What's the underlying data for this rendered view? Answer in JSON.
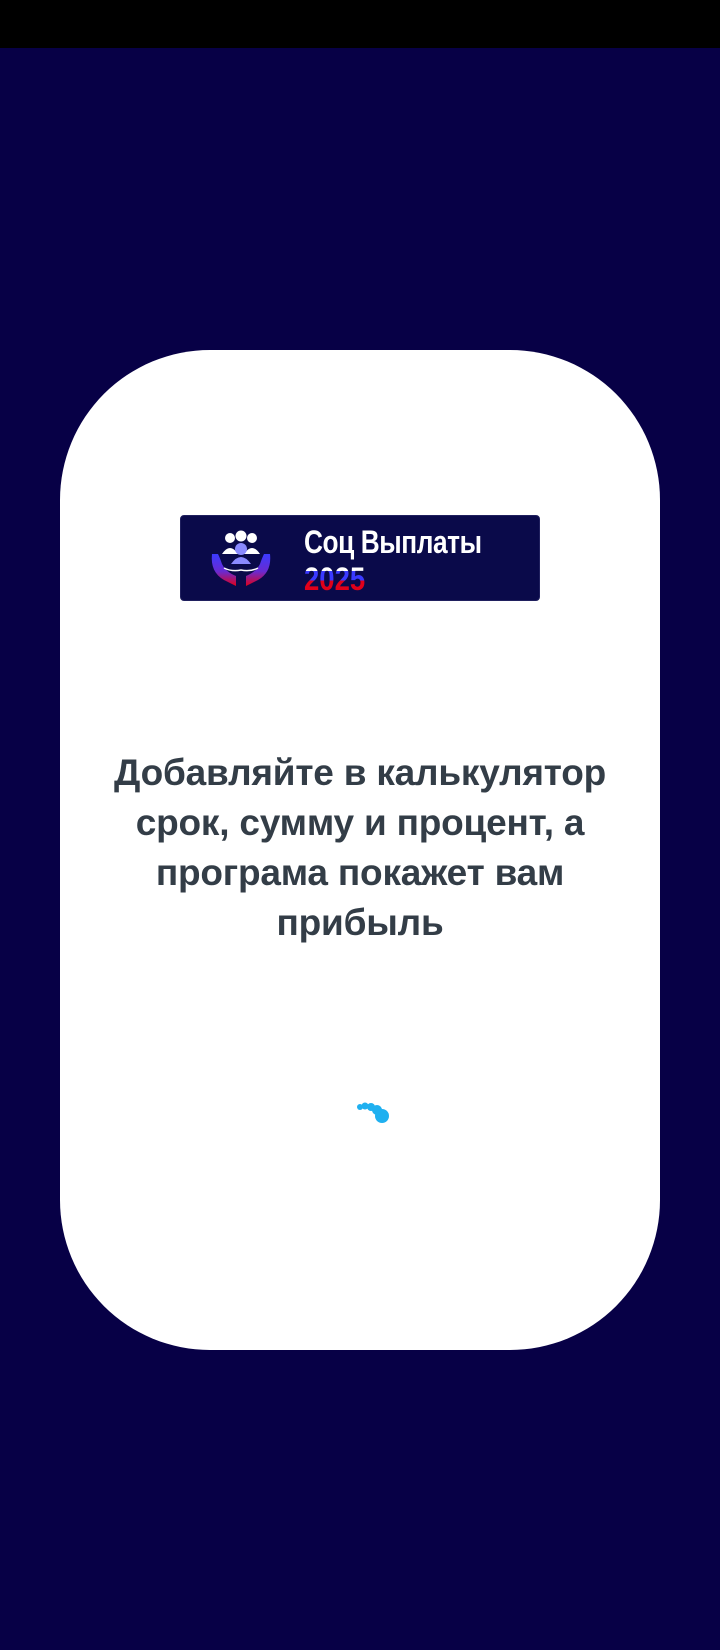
{
  "app": {
    "logo_title": "Соц Выплаты",
    "logo_year": "2025",
    "logo_icon": "hands-holding-people-icon"
  },
  "splash": {
    "message": "Добавляйте в калькулятор срок, сумму и процент, а програма покажет вам прибыль",
    "loading_indicator": "spinner-icon"
  },
  "colors": {
    "background": "#070046",
    "card": "#ffffff",
    "text": "#333d47",
    "spinner": "#1fb0f0"
  }
}
